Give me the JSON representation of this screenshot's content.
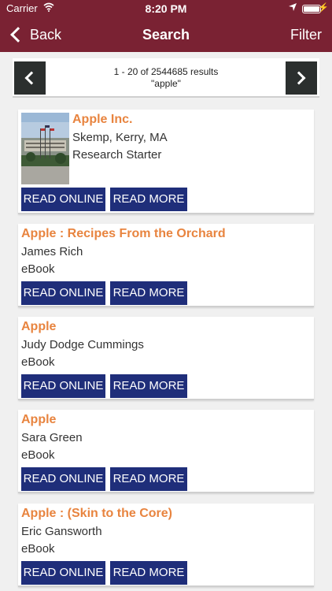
{
  "status_bar": {
    "carrier": "Carrier",
    "time": "8:20 PM"
  },
  "nav": {
    "back": "Back",
    "title": "Search",
    "filter": "Filter"
  },
  "pager": {
    "range": "1 - 20 of 2544685 results",
    "query": "\"apple\""
  },
  "results": [
    {
      "title": "Apple Inc.",
      "author": "Skemp, Kerry, MA",
      "type": "Research Starter",
      "read_online": "READ ONLINE",
      "read_more": "READ MORE"
    },
    {
      "title": "Apple : Recipes From the Orchard",
      "author": "James Rich",
      "type": "eBook",
      "read_online": "READ ONLINE",
      "read_more": "READ MORE"
    },
    {
      "title": "Apple",
      "author": "Judy Dodge Cummings",
      "type": "eBook",
      "read_online": "READ ONLINE",
      "read_more": "READ MORE"
    },
    {
      "title": "Apple",
      "author": "Sara Green",
      "type": "eBook",
      "read_online": "READ ONLINE",
      "read_more": "READ MORE"
    },
    {
      "title": "Apple : (Skin to the Core)",
      "author": "Eric Gansworth",
      "type": "eBook",
      "read_online": "READ ONLINE",
      "read_more": "READ MORE"
    }
  ],
  "colors": {
    "nav_bg": "#7a2233",
    "title": "#e8843f",
    "button": "#1f2e7a",
    "pager_button": "#2b2f2e"
  }
}
